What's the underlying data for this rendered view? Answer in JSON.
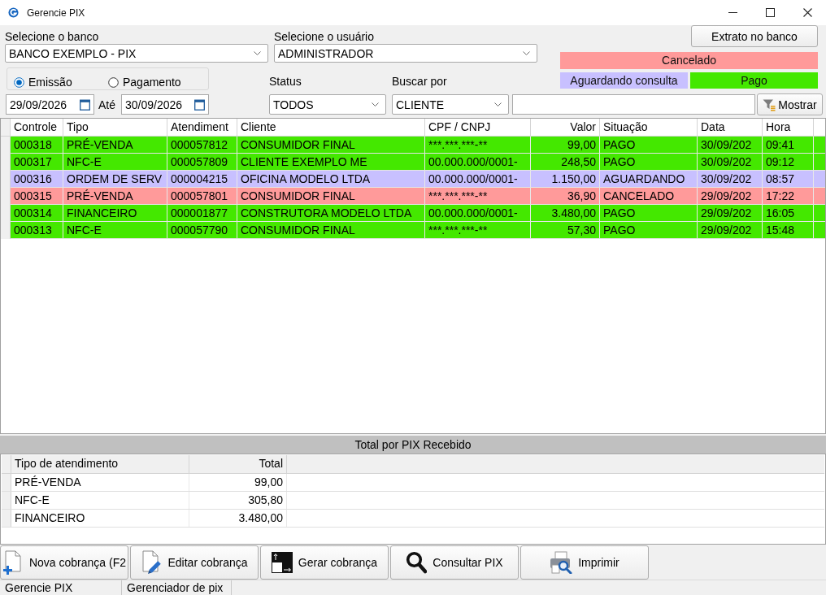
{
  "window": {
    "title": "Gerencie PIX"
  },
  "filters": {
    "bank": {
      "label": "Selecione o banco",
      "value": "BANCO EXEMPLO - PIX"
    },
    "user": {
      "label": "Selecione o usuário",
      "value": "ADMINISTRADOR"
    },
    "date_type": [
      {
        "label": "Emissão",
        "selected": true
      },
      {
        "label": "Pagamento",
        "selected": false
      }
    ],
    "date_from": "29/09/2026",
    "date_to_label": "Até",
    "date_to": "30/09/2026",
    "status": {
      "label": "Status",
      "value": "TODOS"
    },
    "search_by": {
      "label": "Buscar por",
      "value": "CLIENTE"
    },
    "show_button": "Mostrar"
  },
  "statement_button": "Extrato no banco",
  "legend": [
    {
      "label": "Cancelado",
      "color": "#ff9a9a"
    },
    {
      "label": "Aguardando consulta",
      "color": "#c8c0ff"
    },
    {
      "label": "Pago",
      "color": "#44e800"
    }
  ],
  "table": {
    "columns": [
      "Controle",
      "Tipo",
      "Atendiment",
      "Cliente",
      "CPF / CNPJ",
      "Valor",
      "Situação",
      "Data",
      "Hora"
    ],
    "rows": [
      {
        "cells": [
          "000318",
          "PRÉ-VENDA",
          "000057812",
          "CONSUMIDOR FINAL",
          "***.***.***-**",
          "99,00",
          "PAGO",
          "30/09/202",
          "09:41"
        ],
        "color": "#44e800"
      },
      {
        "cells": [
          "000317",
          "NFC-E",
          "000057809",
          "CLIENTE EXEMPLO ME",
          "00.000.000/0001-",
          "248,50",
          "PAGO",
          "30/09/202",
          "09:12"
        ],
        "color": "#44e800"
      },
      {
        "cells": [
          "000316",
          "ORDEM DE SERV",
          "000004215",
          "OFICINA MODELO LTDA",
          "00.000.000/0001-",
          "1.150,00",
          "AGUARDANDO",
          "30/09/202",
          "08:57"
        ],
        "color": "#c8c0ff"
      },
      {
        "cells": [
          "000315",
          "PRÉ-VENDA",
          "000057801",
          "CONSUMIDOR FINAL",
          "***.***.***-**",
          "36,90",
          "CANCELADO",
          "29/09/202",
          "17:22"
        ],
        "color": "#ff9a9a"
      },
      {
        "cells": [
          "000314",
          "FINANCEIRO",
          "000001877",
          "CONSTRUTORA MODELO LTDA",
          "00.000.000/0001-",
          "3.480,00",
          "PAGO",
          "29/09/202",
          "16:05"
        ],
        "color": "#44e800"
      },
      {
        "cells": [
          "000313",
          "NFC-E",
          "000057790",
          "CONSUMIDOR FINAL",
          "***.***.***-**",
          "57,30",
          "PAGO",
          "29/09/202",
          "15:48"
        ],
        "color": "#44e800"
      }
    ]
  },
  "summary": {
    "title": "Total por PIX Recebido",
    "columns": [
      "Tipo de atendimento",
      "Total"
    ],
    "rows": [
      [
        "PRÉ-VENDA",
        "99,00"
      ],
      [
        "NFC-E",
        "305,80"
      ],
      [
        "FINANCEIRO",
        "3.480,00"
      ]
    ]
  },
  "buttons": [
    "Nova cobrança (F2",
    "Editar cobrança",
    "Gerar cobrança",
    "Consultar PIX",
    "Imprimir"
  ],
  "status_bar": [
    "Gerencie PIX",
    "Gerenciador de pix"
  ]
}
